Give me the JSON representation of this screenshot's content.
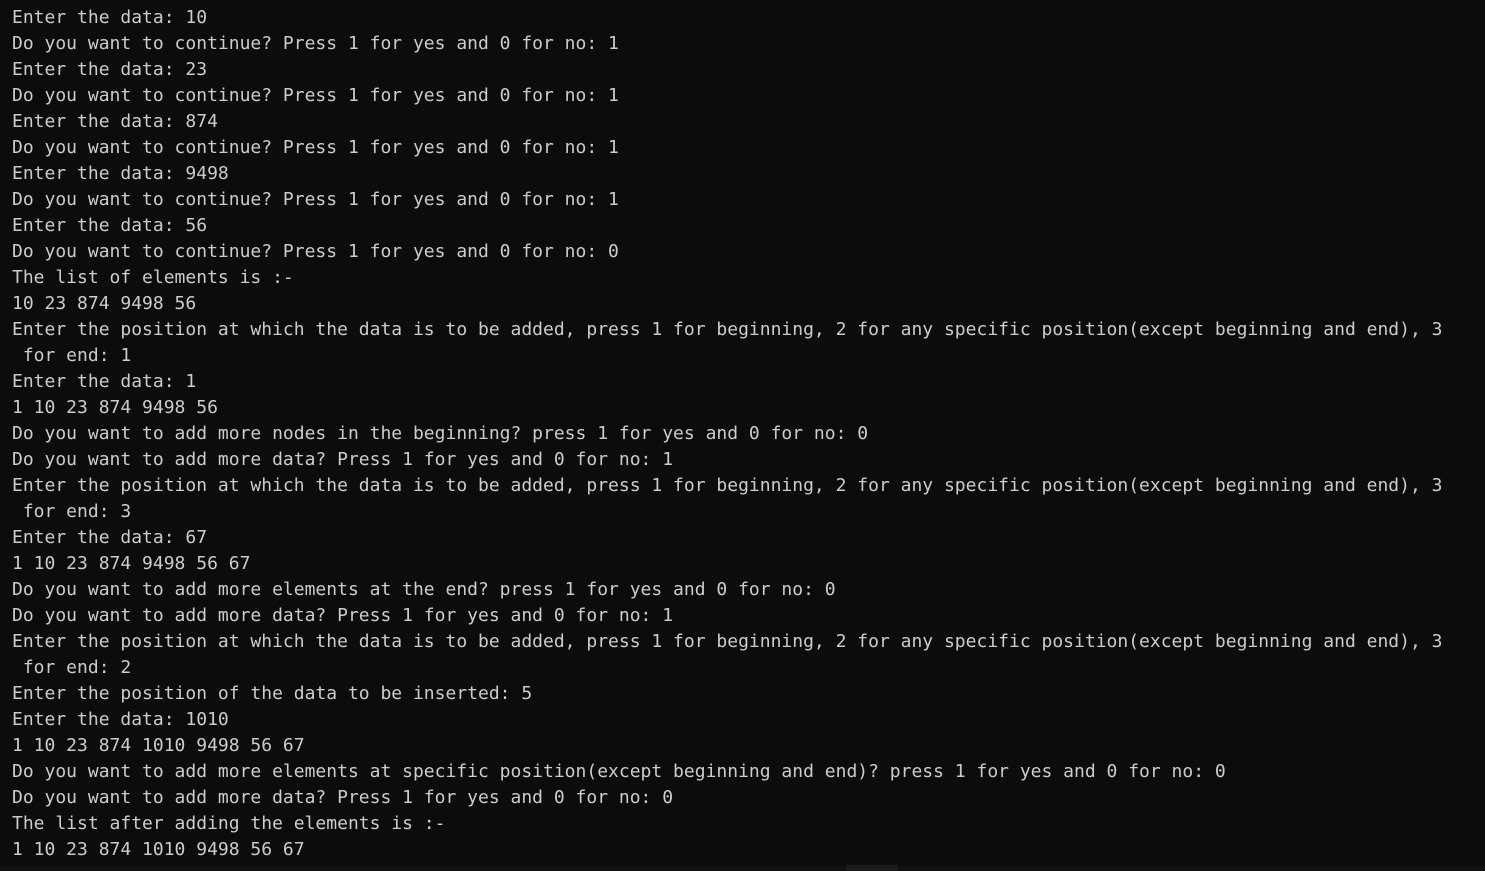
{
  "terminal": {
    "lines": [
      "Enter the data: 10",
      "Do you want to continue? Press 1 for yes and 0 for no: 1",
      "Enter the data: 23",
      "Do you want to continue? Press 1 for yes and 0 for no: 1",
      "Enter the data: 874",
      "Do you want to continue? Press 1 for yes and 0 for no: 1",
      "Enter the data: 9498",
      "Do you want to continue? Press 1 for yes and 0 for no: 1",
      "Enter the data: 56",
      "Do you want to continue? Press 1 for yes and 0 for no: 0",
      "The list of elements is :-",
      "10 23 874 9498 56",
      "Enter the position at which the data is to be added, press 1 for beginning, 2 for any specific position(except beginning and end), 3",
      " for end: 1",
      "Enter the data: 1",
      "1 10 23 874 9498 56",
      "Do you want to add more nodes in the beginning? press 1 for yes and 0 for no: 0",
      "Do you want to add more data? Press 1 for yes and 0 for no: 1",
      "Enter the position at which the data is to be added, press 1 for beginning, 2 for any specific position(except beginning and end), 3",
      " for end: 3",
      "Enter the data: 67",
      "1 10 23 874 9498 56 67",
      "Do you want to add more elements at the end? press 1 for yes and 0 for no: 0",
      "Do you want to add more data? Press 1 for yes and 0 for no: 1",
      "Enter the position at which the data is to be added, press 1 for beginning, 2 for any specific position(except beginning and end), 3",
      " for end: 2",
      "Enter the position of the data to be inserted: 5",
      "Enter the data: 1010",
      "1 10 23 874 1010 9498 56 67",
      "Do you want to add more elements at specific position(except beginning and end)? press 1 for yes and 0 for no: 0",
      "Do you want to add more data? Press 1 for yes and 0 for no: 0",
      "The list after adding the elements is :-",
      "1 10 23 874 1010 9498 56 67"
    ]
  },
  "colors": {
    "background": "#0c0c0c",
    "text": "#cccccc"
  }
}
